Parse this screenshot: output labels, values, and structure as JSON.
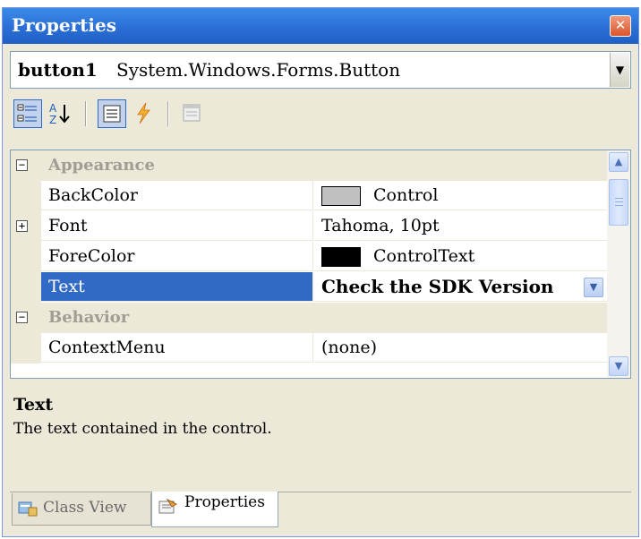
{
  "window": {
    "title": "Properties"
  },
  "object_selector": {
    "name": "button1",
    "type": "System.Windows.Forms.Button"
  },
  "toolbar": {
    "icons": [
      "categorized-icon",
      "alphabetical-icon",
      "properties-icon",
      "events-icon",
      "property-pages-icon"
    ]
  },
  "grid": {
    "categories": [
      {
        "name": "Appearance",
        "expanded": true
      },
      {
        "name": "Behavior",
        "expanded": true
      }
    ],
    "rows": {
      "backcolor": {
        "name": "BackColor",
        "value": "Control",
        "swatch": "#c0c0c0"
      },
      "font": {
        "name": "Font",
        "value": "Tahoma, 10pt"
      },
      "forecolor": {
        "name": "ForeColor",
        "value": "ControlText",
        "swatch": "#000000"
      },
      "text": {
        "name": "Text",
        "value": "Check the SDK Version"
      },
      "contextmenu": {
        "name": "ContextMenu",
        "value": "(none)"
      }
    }
  },
  "description": {
    "title": "Text",
    "text": "The text contained in the control."
  },
  "tabs": [
    {
      "label": "Class View",
      "active": false
    },
    {
      "label": "Properties",
      "active": true
    }
  ],
  "colors": {
    "title_bar": "#2b6fd6",
    "selection": "#316ac5",
    "chrome": "#ece9d8"
  }
}
